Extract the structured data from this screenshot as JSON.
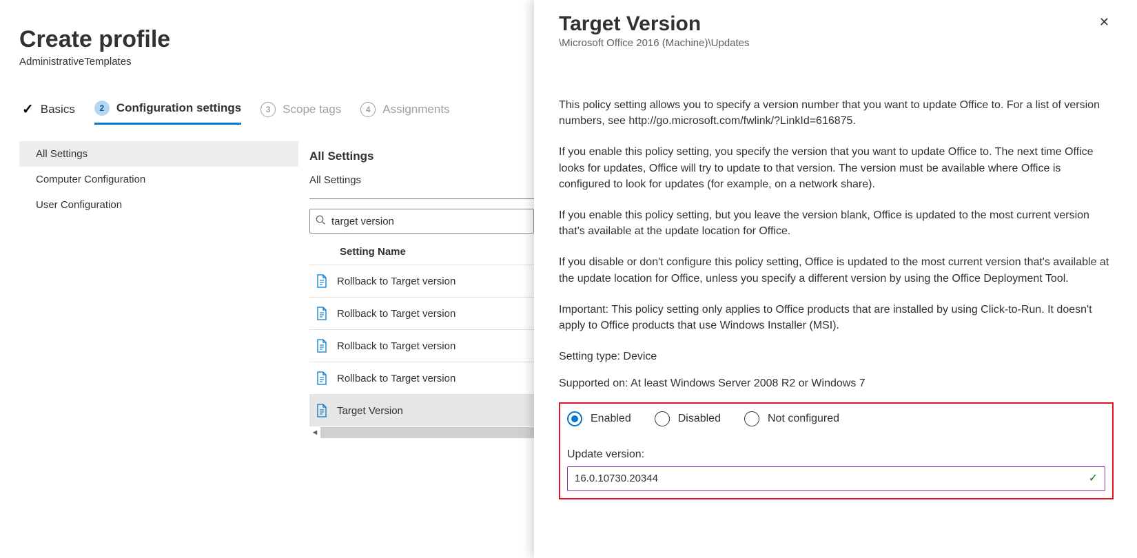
{
  "page": {
    "title": "Create profile",
    "subtitle": "AdministrativeTemplates"
  },
  "tabs": [
    {
      "label": "Basics",
      "state": "completed"
    },
    {
      "label": "Configuration settings",
      "num": "2",
      "state": "active"
    },
    {
      "label": "Scope tags",
      "num": "3",
      "state": "inactive"
    },
    {
      "label": "Assignments",
      "num": "4",
      "state": "inactive"
    }
  ],
  "sidebar": {
    "items": [
      {
        "label": "All Settings",
        "selected": true
      },
      {
        "label": "Computer Configuration",
        "selected": false
      },
      {
        "label": "User Configuration",
        "selected": false
      }
    ]
  },
  "settings": {
    "heading": "All Settings",
    "subheading": "All Settings",
    "search_value": "target version",
    "column_header": "Setting Name",
    "rows": [
      {
        "label": "Rollback to Target version",
        "selected": false
      },
      {
        "label": "Rollback to Target version",
        "selected": false
      },
      {
        "label": "Rollback to Target version",
        "selected": false
      },
      {
        "label": "Rollback to Target version",
        "selected": false
      },
      {
        "label": "Target Version",
        "selected": true
      }
    ]
  },
  "panel": {
    "title": "Target Version",
    "path": "\\Microsoft Office 2016 (Machine)\\Updates",
    "para1": "This policy setting allows you to specify a version number that you want to update Office to. For a list of version numbers, see http://go.microsoft.com/fwlink/?LinkId=616875.",
    "para2": "If you enable this policy setting, you specify the version that you want to update Office to. The next time Office looks for updates, Office will try to update to that version. The version must be available where Office is configured to look for updates (for example, on a network share).",
    "para3": "If you enable this policy setting, but you leave the version blank, Office is updated to the most current version that's available at the update location for Office.",
    "para4": "If you disable or don't configure this policy setting, Office is updated to the most current version that's available at the update location for Office, unless you specify a different version by using the Office Deployment Tool.",
    "para5": "Important:  This policy setting only applies to Office products that are installed by using Click-to-Run. It doesn't apply to Office products that use Windows Installer (MSI).",
    "setting_type": "Setting type: Device",
    "supported_on": "Supported on: At least Windows Server 2008 R2 or Windows 7",
    "radios": {
      "enabled": "Enabled",
      "disabled": "Disabled",
      "not_configured": "Not configured"
    },
    "field_label": "Update version:",
    "field_value": "16.0.10730.20344"
  }
}
